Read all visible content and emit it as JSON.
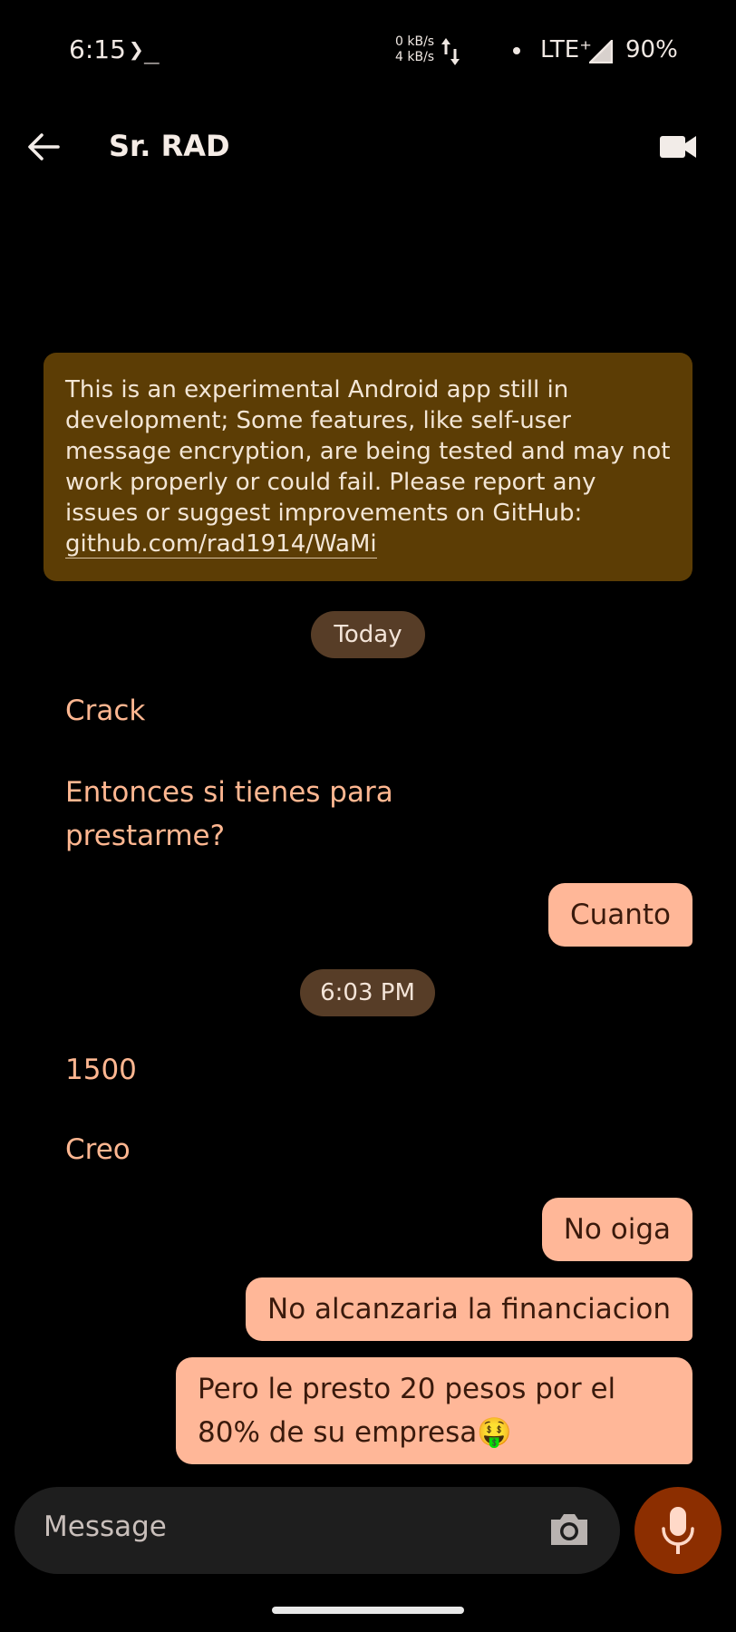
{
  "status_bar": {
    "time": "6:15",
    "terminal_glyph": "❯_",
    "net_up": "0 kB/s",
    "net_down": "4 kB/s",
    "network": "LTE⁺",
    "battery": "90%"
  },
  "app_bar": {
    "contact_name": "Sr. RAD",
    "back_icon": "arrow-back-icon",
    "video_icon": "video-call-icon"
  },
  "notice": {
    "text": "This is an experimental Android app still in development; Some features, like self-user message encryption, are being tested and may not work properly or could fail. Please report any issues or suggest improvements on GitHub: ",
    "link": "github.com/rad1914/WaMi",
    "color": "#5c3d05"
  },
  "conversation": {
    "date_chip_1": "Today",
    "msg_1": "Crack",
    "msg_2": "Entonces si tienes para prestarme?",
    "msg_3": "Cuanto",
    "date_chip_2": "6:03 PM",
    "msg_4": "1500",
    "msg_5": "Creo",
    "msg_6": "No oiga",
    "msg_7": "No alcanzaria la financiacion",
    "msg_8": "Pero le presto 20 pesos por el 80% de su empresa🤑",
    "incoming_color": "#ffb791",
    "outgoing_bubble_color": "#ffb798"
  },
  "composer": {
    "placeholder": "Message",
    "camera_icon": "camera-icon",
    "mic_icon": "microphone-icon",
    "mic_button_color": "#8c2e00"
  }
}
